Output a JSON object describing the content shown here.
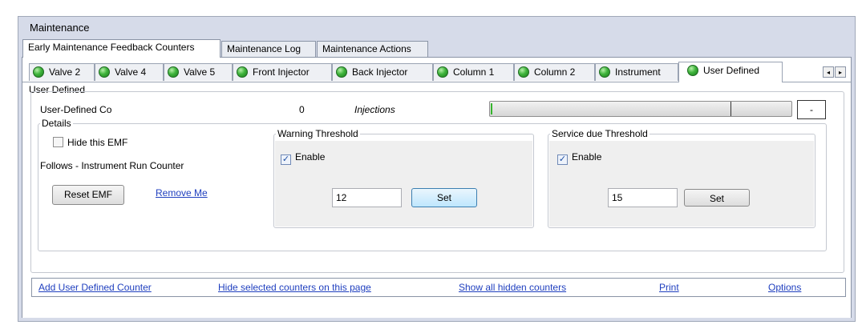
{
  "window": {
    "title": "Maintenance"
  },
  "main_tabs": [
    {
      "label": "Early Maintenance Feedback Counters",
      "active": true
    },
    {
      "label": "Maintenance Log",
      "active": false
    },
    {
      "label": "Maintenance Actions",
      "active": false
    }
  ],
  "sub_tabs": [
    {
      "label": "Valve 2"
    },
    {
      "label": "Valve 4"
    },
    {
      "label": "Valve 5"
    },
    {
      "label": "Front Injector"
    },
    {
      "label": "Back Injector"
    },
    {
      "label": "Column 1"
    },
    {
      "label": "Column 2"
    },
    {
      "label": "Instrument"
    },
    {
      "label": "User Defined",
      "active": true
    }
  ],
  "scroll": {
    "left_icon": "◂",
    "right_icon": "▸"
  },
  "user_defined": {
    "group_title": "User Defined",
    "counter_name": "User-Defined Co",
    "counter_value": "0",
    "counter_unit": "Injections",
    "progress_fraction": 0.0,
    "minus_label": "-",
    "details": {
      "title": "Details",
      "hide_label": "Hide this EMF",
      "hide_checked": false,
      "follows_text": "Follows - Instrument Run Counter",
      "reset_label": "Reset EMF",
      "remove_label": "Remove Me"
    },
    "warning": {
      "title": "Warning Threshold",
      "enable_label": "Enable",
      "enabled": true,
      "value": "12",
      "set_label": "Set"
    },
    "service": {
      "title": "Service due Threshold",
      "enable_label": "Enable",
      "enabled": true,
      "value": "15",
      "set_label": "Set"
    }
  },
  "links": {
    "add": "Add User Defined Counter",
    "hide": "Hide selected counters on this page",
    "show": "Show all hidden counters",
    "print": "Print",
    "options": "Options"
  },
  "colors": {
    "status_green": "#3fb43c",
    "link": "#1f3fbf",
    "panel_bg": "#d6dbe9"
  }
}
